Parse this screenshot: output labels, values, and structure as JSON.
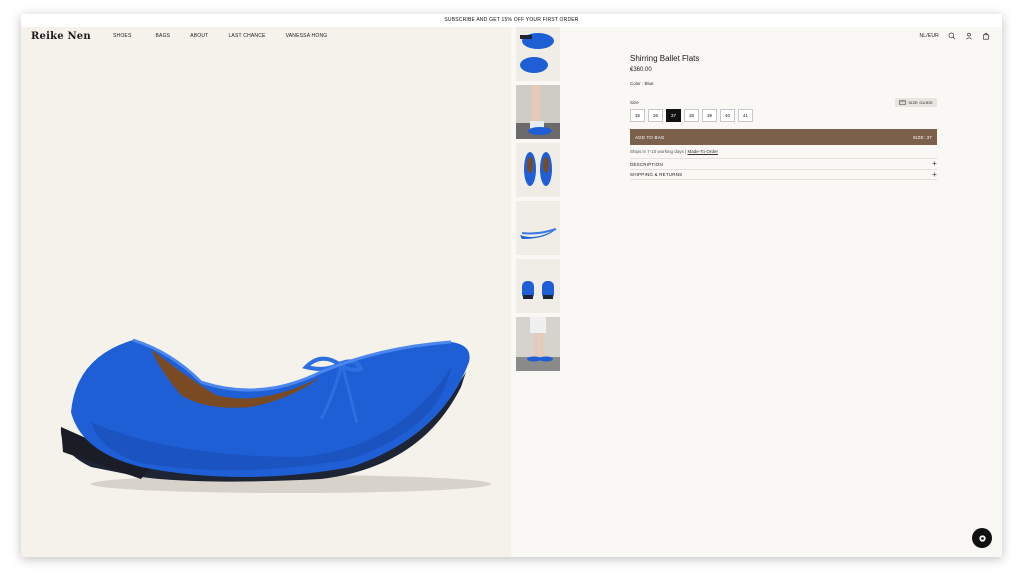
{
  "announcement": "SUBSCRIBE AND GET 15% OFF YOUR FIRST ORDER",
  "header": {
    "logo": "Reike Nen",
    "nav": [
      "SHOES",
      "BAGS",
      "ABOUT",
      "LAST CHANCE",
      "VANESSA HONG"
    ],
    "locale": "NL/EUR",
    "icons": [
      "search-icon",
      "account-icon",
      "bag-icon"
    ]
  },
  "product": {
    "title": "Shirring Ballet Flats",
    "price": "€360.00",
    "color_text": "Color : Blue",
    "size_label": "Size",
    "size_guide": "SIZE GUIDE",
    "sizes": [
      "35",
      "36",
      "37",
      "38",
      "39",
      "40",
      "41"
    ],
    "selected_size": "37",
    "add_to_bag": "ADD TO BAG",
    "size_summary": "SIZE: 37",
    "ships_text": "Ships in 7-10 working days | ",
    "made_to_order": "Made-To-Order",
    "accordion": [
      "DESCRIPTION",
      "SHIPPING & RETURNS"
    ]
  },
  "colors": {
    "accent_brown": "#7b614c",
    "shoe_blue": "#1f5fd6",
    "background": "#faf8f5"
  }
}
